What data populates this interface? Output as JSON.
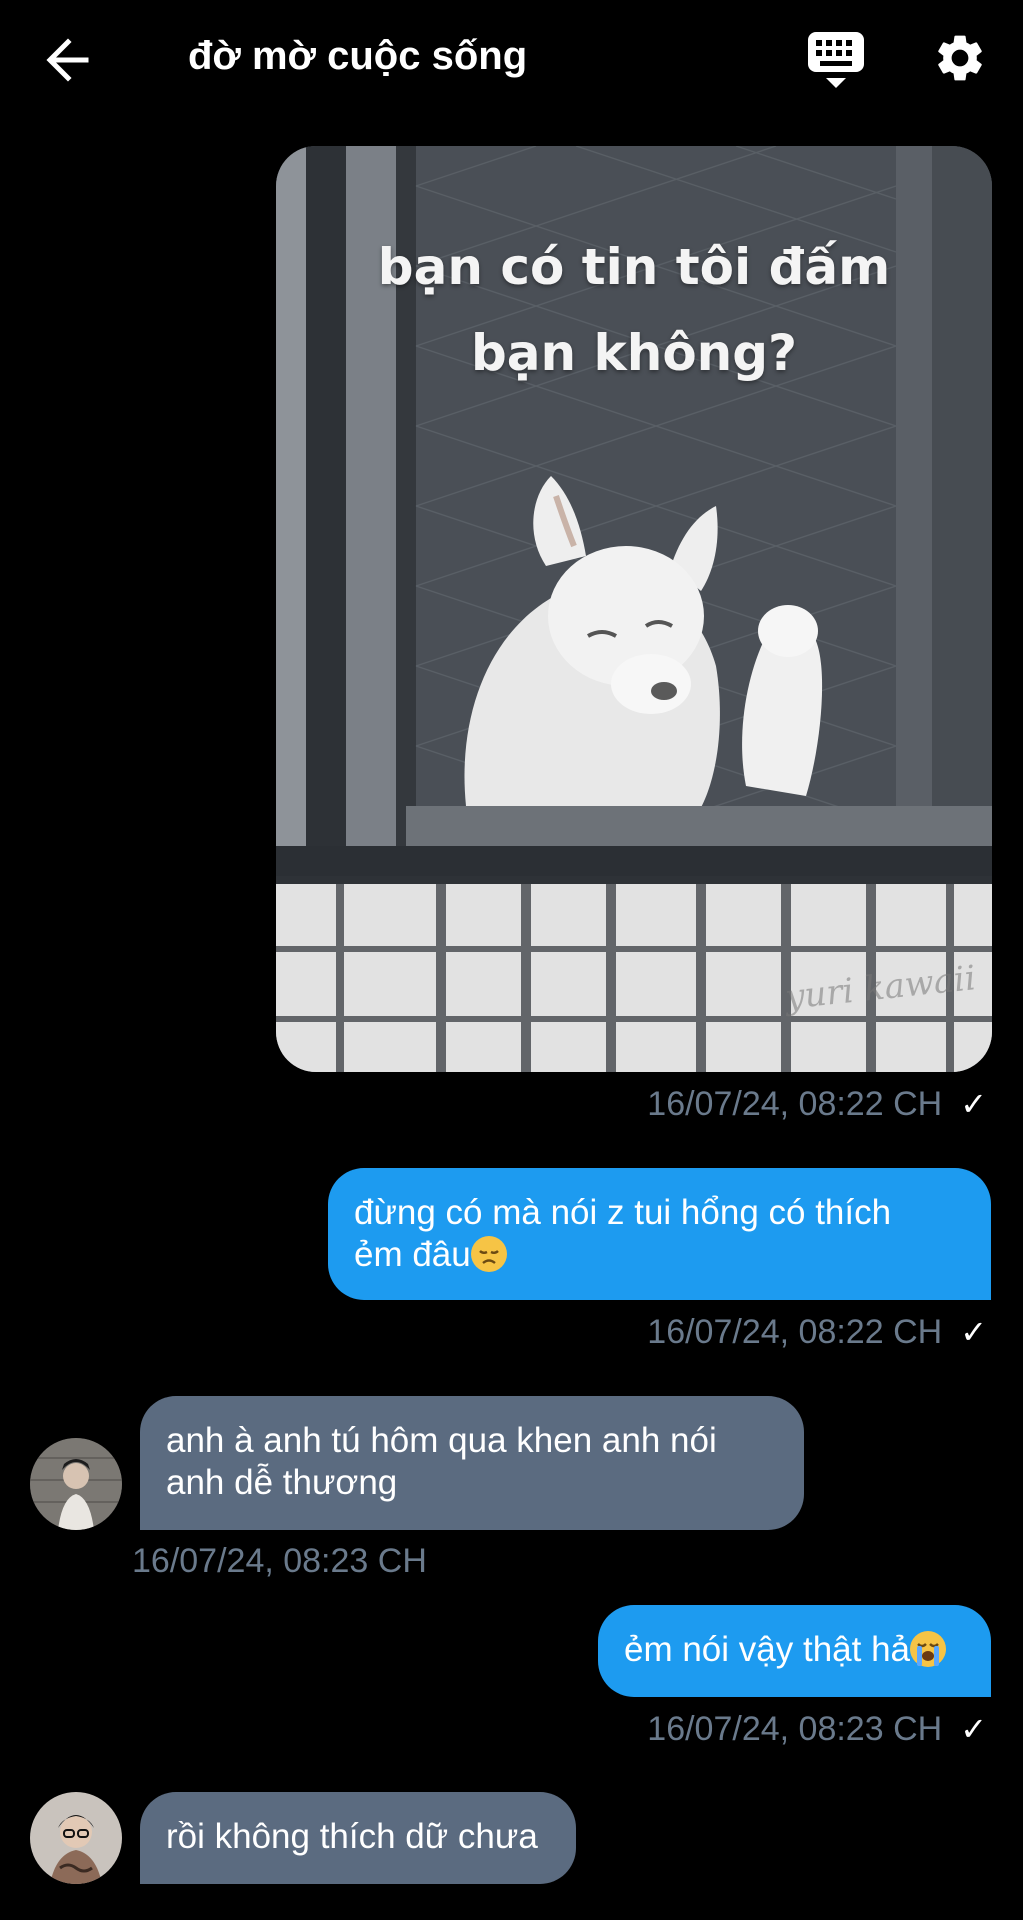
{
  "header": {
    "title": "đờ mờ cuộc sống",
    "back_icon": "arrow-left-icon",
    "keyboard_icon": "keyboard-icon",
    "settings_icon": "gear-icon"
  },
  "messages": [
    {
      "type": "image",
      "direction": "outgoing",
      "caption": "bạn có tin tôi đấm bạn không?",
      "caption_lines": [
        "bạn có tin tôi đấm",
        "bạn không?"
      ],
      "watermark": "yuri kawaii",
      "timestamp": "16/07/24, 08:22 CH",
      "status": "sent"
    },
    {
      "type": "text",
      "direction": "outgoing",
      "lines": [
        "đừng có mà nói z tui hổng có thích",
        "ẻm đâu"
      ],
      "emoji": "disappointed-face",
      "timestamp": "16/07/24, 08:22 CH",
      "status": "sent"
    },
    {
      "type": "text",
      "direction": "incoming",
      "lines": [
        "anh à anh tú hôm qua khen anh nói",
        "anh dễ thương"
      ],
      "timestamp": "16/07/24, 08:23 CH"
    },
    {
      "type": "text",
      "direction": "outgoing",
      "lines": [
        "ẻm nói vậy thật hả"
      ],
      "emoji": "loudly-crying-face",
      "timestamp": "16/07/24, 08:23 CH",
      "status": "sent"
    },
    {
      "type": "text",
      "direction": "incoming",
      "lines": [
        "rồi không thích dữ chưa"
      ]
    }
  ],
  "colors": {
    "background": "#000000",
    "outgoing_bubble": "#1d9bf0",
    "incoming_bubble": "#5b6b80",
    "timestamp": "#6a7a8c"
  }
}
